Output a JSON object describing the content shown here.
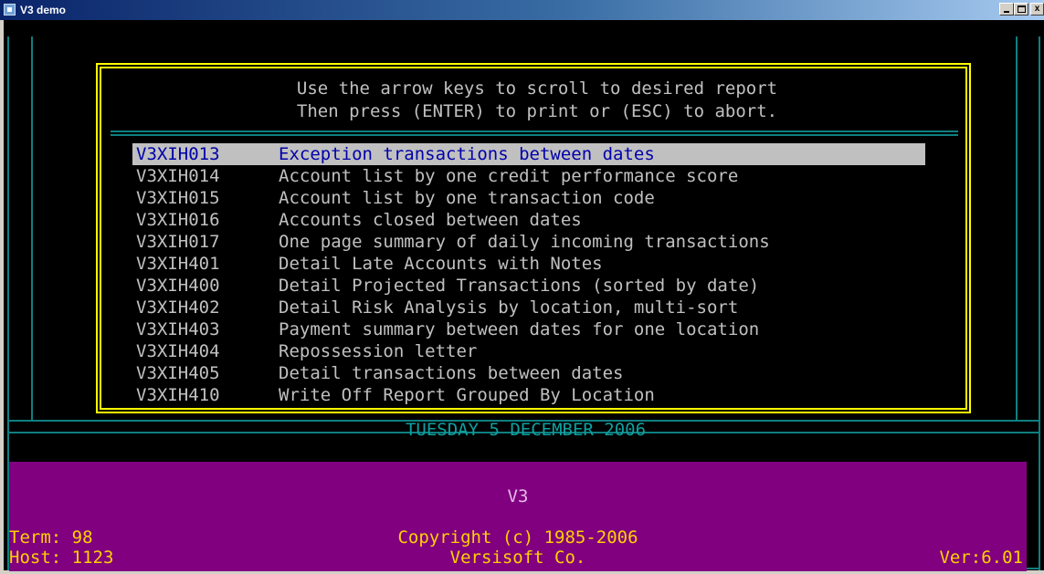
{
  "window": {
    "title": "V3 demo",
    "min_label": "",
    "max_label": "",
    "close_label": "x"
  },
  "menu": {
    "instruction_line1": "Use the arrow keys to scroll to desired report",
    "instruction_line2": "Then press (ENTER) to print or (ESC) to abort.",
    "selected_index": 0,
    "reports": [
      {
        "code": "V3XIH013",
        "description": "Exception transactions between dates"
      },
      {
        "code": "V3XIH014",
        "description": "Account list by one credit performance score"
      },
      {
        "code": "V3XIH015",
        "description": "Account list by one transaction code"
      },
      {
        "code": "V3XIH016",
        "description": "Accounts closed between dates"
      },
      {
        "code": "V3XIH017",
        "description": "One page summary of daily incoming transactions"
      },
      {
        "code": "V3XIH401",
        "description": "Detail Late Accounts with Notes"
      },
      {
        "code": "V3XIH400",
        "description": "Detail Projected Transactions (sorted by date)"
      },
      {
        "code": "V3XIH402",
        "description": "Detail Risk Analysis by location, multi-sort"
      },
      {
        "code": "V3XIH403",
        "description": "Payment summary between dates for one location"
      },
      {
        "code": "V3XIH404",
        "description": "Repossession letter"
      },
      {
        "code": "V3XIH405",
        "description": "Detail transactions between dates"
      },
      {
        "code": "V3XIH410",
        "description": "Write Off Report Grouped By Location"
      }
    ]
  },
  "status": {
    "date": "TUESDAY 5 DECEMBER 2006"
  },
  "footer": {
    "app_name": "V3",
    "term": "Term: 98",
    "host": "Host: 1123",
    "copyright": "Copyright (c) 1985-2006",
    "company": "Versisoft Co.",
    "version": "Ver:6.01"
  },
  "colors": {
    "frame": "#0f7f80",
    "menu_border": "#ffff00",
    "footer_bg": "#800080",
    "footer_text": "#ffd000",
    "selection_bg": "#c0c0c0",
    "selection_text": "#0000aa"
  }
}
